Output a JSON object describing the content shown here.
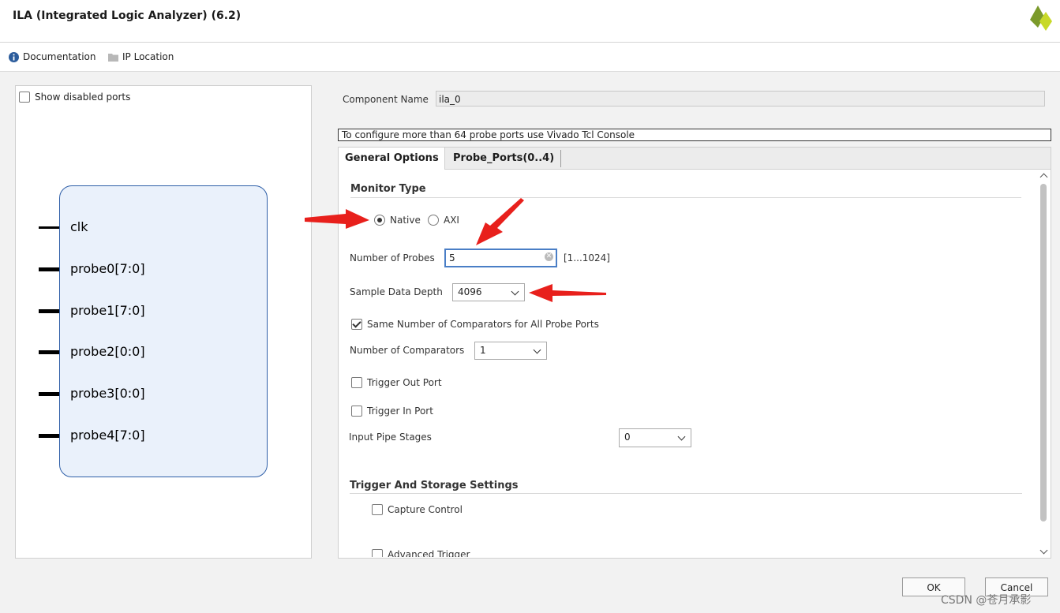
{
  "window": {
    "title": "ILA (Integrated Logic Analyzer) (6.2)"
  },
  "toolbar": {
    "documentation": "Documentation",
    "ip_location": "IP Location"
  },
  "left_panel": {
    "show_disabled_label": "Show disabled ports",
    "show_disabled_checked": false,
    "ports": [
      "clk",
      "probe0[7:0]",
      "probe1[7:0]",
      "probe2[0:0]",
      "probe3[0:0]",
      "probe4[7:0]"
    ]
  },
  "component": {
    "label": "Component Name",
    "value": "ila_0"
  },
  "note": "To configure more than 64 probe ports use Vivado Tcl Console",
  "tabs": [
    "General Options",
    "Probe_Ports(0..4)"
  ],
  "general": {
    "monitor_type_title": "Monitor Type",
    "monitor_native": "Native",
    "monitor_axi": "AXI",
    "selected_monitor": "Native",
    "num_probes_label": "Number of Probes",
    "num_probes_value": "5",
    "num_probes_range": "[1...1024]",
    "sample_depth_label": "Sample Data Depth",
    "sample_depth_value": "4096",
    "same_comparators_label": "Same Number of Comparators for All Probe Ports",
    "same_comparators_checked": true,
    "num_comparators_label": "Number of Comparators",
    "num_comparators_value": "1",
    "trigger_out_label": "Trigger Out Port",
    "trigger_in_label": "Trigger In Port",
    "input_pipe_label": "Input Pipe Stages",
    "input_pipe_value": "0",
    "trigger_storage_title": "Trigger And Storage Settings",
    "capture_control_label": "Capture Control",
    "advanced_trigger_label": "Advanced Trigger"
  },
  "buttons": {
    "ok": "OK",
    "cancel": "Cancel"
  },
  "watermark": "CSDN @苍月承影",
  "colors": {
    "accent": "#2f5fa8",
    "annotation_arrow": "#e8201c",
    "focus": "#4a7ec6"
  },
  "icons": {
    "info": "info-icon",
    "folder": "folder-icon",
    "logo": "xilinx-logo-icon"
  }
}
